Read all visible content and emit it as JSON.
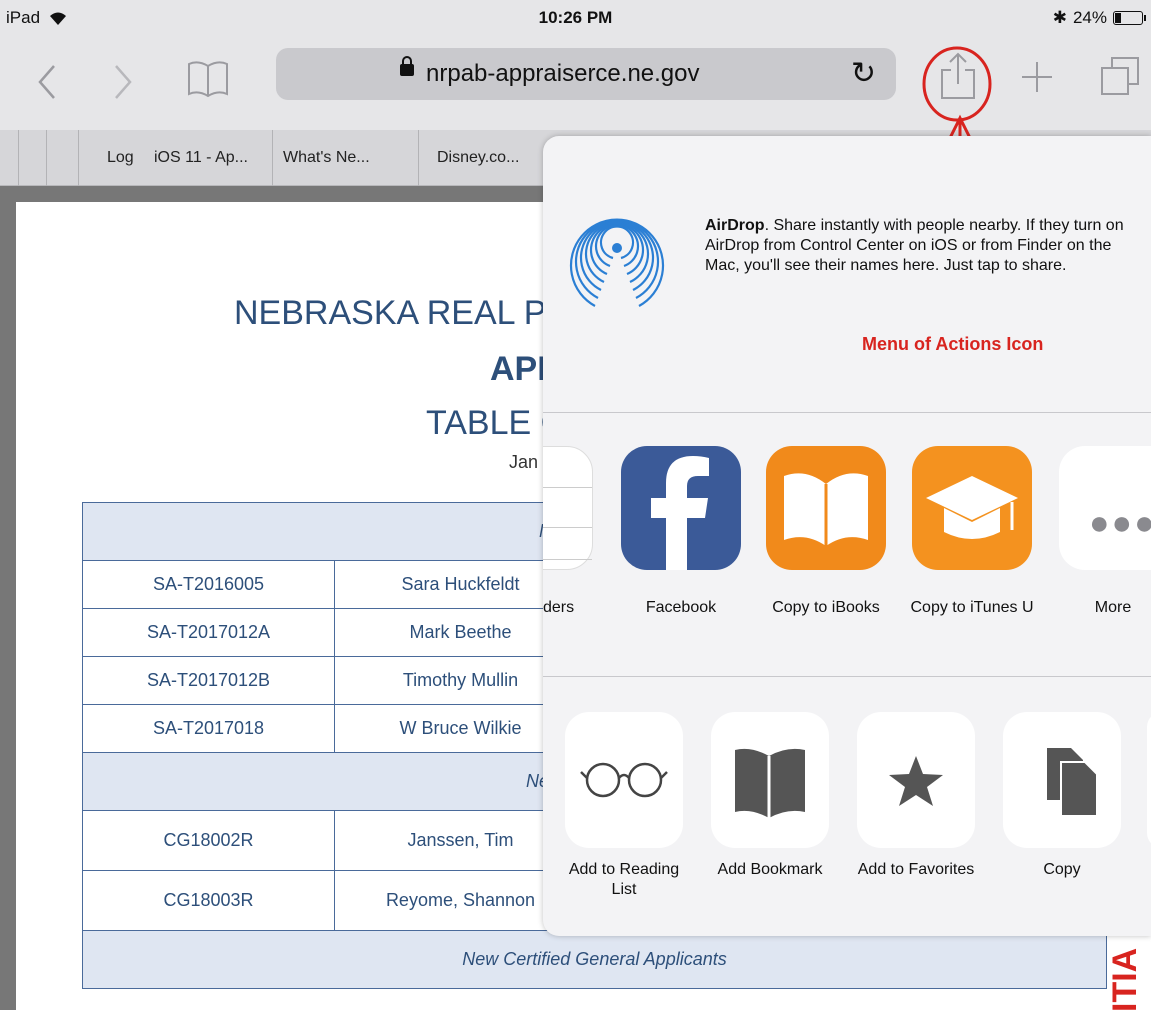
{
  "status_bar": {
    "device": "iPad",
    "time": "10:26 PM",
    "battery_percent": "24%",
    "battery_fraction": 0.24
  },
  "toolbar": {
    "url": "nrpab-appraiserce.ne.gov",
    "back_icon": "chevron-left-icon",
    "forward_icon": "chevron-right-icon",
    "bookmarks_icon": "book-icon",
    "share_icon": "share-icon",
    "new_tab_icon": "plus-icon",
    "tabs_icon": "tabs-icon",
    "reload_icon": "reload-icon"
  },
  "bookmarks_bar": {
    "items": [
      "Log",
      "iOS 11 - Ap...",
      "What's Ne...",
      "Disney.co..."
    ]
  },
  "document": {
    "title_line1": "NEBRASKA REAL PRC",
    "title_line2": "APF",
    "title_line3": "TABLE C",
    "date_fragment": "Jan",
    "rows": [
      {
        "type": "section",
        "text": "New Supervis"
      },
      {
        "type": "row",
        "id": "SA-T2016005",
        "name": "Sara Huckfeldt"
      },
      {
        "type": "row",
        "id": "SA-T2017012A",
        "name": "Mark Beethe"
      },
      {
        "type": "row",
        "id": "SA-T2017012B",
        "name": "Timothy Mullin"
      },
      {
        "type": "row",
        "id": "SA-T2017018",
        "name": "W Bruce Wilkie"
      },
      {
        "type": "section",
        "text": "New Certified Ge"
      },
      {
        "type": "row",
        "id": "CG18002R",
        "name": "Janssen, Tim"
      },
      {
        "type": "row",
        "id": "CG18003R",
        "name": "Reyome, Shannon"
      },
      {
        "type": "section",
        "text": "New Certified General Applicants"
      }
    ],
    "side_text": "ITIA"
  },
  "share_sheet": {
    "airdrop_title": "AirDrop",
    "airdrop_text": ". Share instantly with people nearby. If they turn on AirDrop from Control Center on iOS or from Finder on the Mac, you'll see their names here. Just tap to share.",
    "apps": [
      {
        "label": "ders",
        "icon": "reminders-icon"
      },
      {
        "label": "Facebook",
        "icon": "facebook-icon"
      },
      {
        "label": "Copy to iBooks",
        "icon": "ibooks-icon"
      },
      {
        "label": "Copy to iTunes U",
        "icon": "itunes-u-icon"
      },
      {
        "label": "More",
        "icon": "more-icon"
      }
    ],
    "actions": [
      {
        "label": "Add to Reading List",
        "icon": "glasses-icon"
      },
      {
        "label": "Add Bookmark",
        "icon": "book-icon"
      },
      {
        "label": "Add to Favorites",
        "icon": "star-icon"
      },
      {
        "label": "Copy",
        "icon": "copy-icon"
      }
    ]
  },
  "annotation": {
    "label": "Menu of Actions Icon",
    "color": "#d8241f"
  },
  "colors": {
    "facebook": "#3b5a98",
    "ibooks": "#f18a1b",
    "itunes_u": "#f4921f",
    "airdrop": "#2b7fd4"
  }
}
